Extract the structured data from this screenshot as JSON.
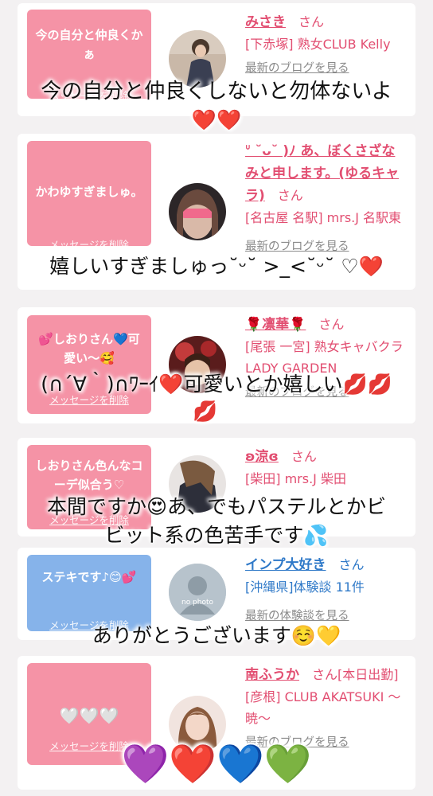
{
  "cards": [
    {
      "bubble": {
        "text": "今の自分と仲良くかぁ",
        "delete_label": "メッセージを削除",
        "color": "pink"
      },
      "name": "みさき",
      "honorific": "さん",
      "shop": "[下赤塚] 熟女CLUB Kelly",
      "blog": "最新のブログを見る"
    },
    {
      "bubble": {
        "text": "かわゆすぎましゅ。",
        "delete_label": "メッセージを削除",
        "color": "pink"
      },
      "name": "ᐡ˘ᴗ˘ᐡ )ﾉ",
      "name_full": "ᐡ˘ᴗ˘ᐡ )ﾉ",
      "name_text": "ᐡ ˘ᴗ˘ )ﾉ あ、ぼくさざなみと申します。(ゆるキャラ)",
      "honorific": "さん",
      "shop": "[名古屋 名駅] mrs.J 名駅東",
      "blog": "最新のブログを見る"
    },
    {
      "bubble": {
        "text": "💕しおりさん💙可愛い〜🥰",
        "delete_label": "メッセージを削除",
        "color": "pink"
      },
      "name": "🌹凛華🌹",
      "honorific": "さん",
      "shop": "[尾張 一宮] 熟女キャバクラ LADY GARDEN",
      "blog": "最新のブログを見る"
    },
    {
      "bubble": {
        "text": "しおりさん色んなコーデ似合う♡",
        "delete_label": "メッセージを削除",
        "color": "pink"
      },
      "name": "ʚ涼ɞ",
      "honorific": "さん",
      "shop": "[柴田] mrs.J 柴田",
      "blog": "最新のブログを見る"
    },
    {
      "bubble": {
        "text": "ステキです♪😊💕",
        "delete_label": "メッセージを削除",
        "color": "blue"
      },
      "name": "インプ大好き",
      "honorific": "さん",
      "shop": "[沖縄県]体験談 11件",
      "blog": "最新の体験談を見る",
      "avatar_text": "no photo"
    },
    {
      "bubble": {
        "text": "🤍🤍🤍",
        "delete_label": "メッセージを削除",
        "color": "pink"
      },
      "name": "南ふうか",
      "honorific": "さん[本日出勤]",
      "shop": "[彦根] CLUB AKATSUKI 〜暁〜",
      "blog": "最新のブログを見る"
    }
  ],
  "replies": [
    "今の自分と仲良くしないと勿体ないよ",
    "❤️❤️",
    "嬉しいすぎましゅっ˘ᵕ˘ >_<˘ᵕ˘ ♡❤️",
    "(∩´∀｀)∩ﾜｰｲ❤️可愛いとか嬉しい💋💋",
    "💋",
    "本間ですか😍あ、でもパステルとかビ",
    "ビット系の色苦手です💦",
    "ありがとうございます☺️💛",
    "💜❤️💙💚"
  ],
  "colors": {
    "accent": "#e24e71",
    "bubble_pink": "#f593a6",
    "bubble_blue": "#86b3ea",
    "link_blue": "#2f79c8"
  }
}
